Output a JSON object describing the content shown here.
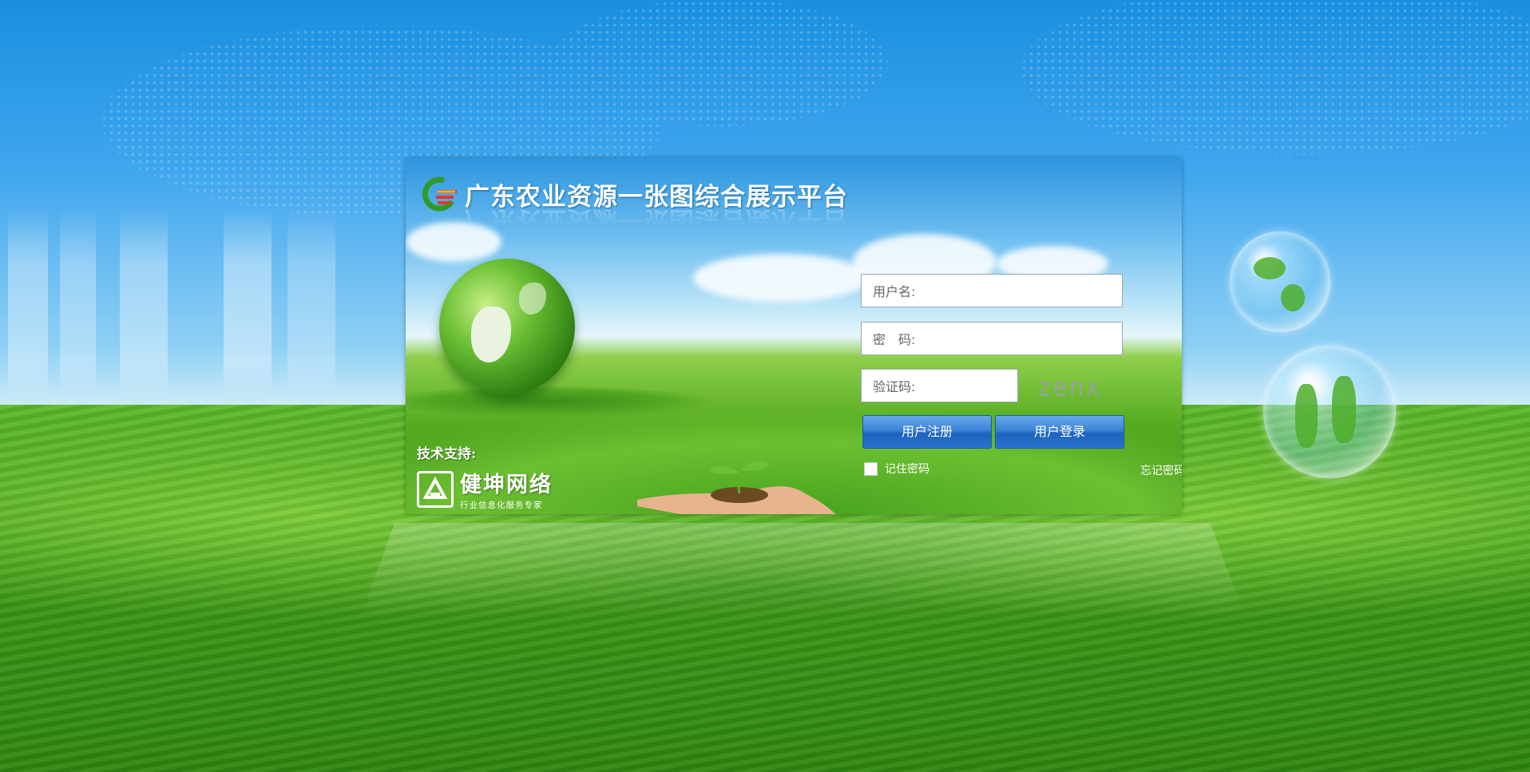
{
  "platform": {
    "title": "广东农业资源一张图综合展示平台"
  },
  "support": {
    "label": "技术支持:",
    "company_name": "健坤网络",
    "company_tagline": "行业信息化服务专家"
  },
  "login_form": {
    "username_label": "用户名:",
    "password_label": "密　码:",
    "captcha_label": "验证码:",
    "captcha_text": "zenx",
    "register_button": "用户注册",
    "login_button": "用户登录",
    "remember_label": "记住密码",
    "remember_checked": false,
    "forgot_link": "忘记密码"
  },
  "colors": {
    "button_blue": "#2a73cb",
    "grass_green": "#4fae2a",
    "sky_blue": "#1a8fe0"
  }
}
